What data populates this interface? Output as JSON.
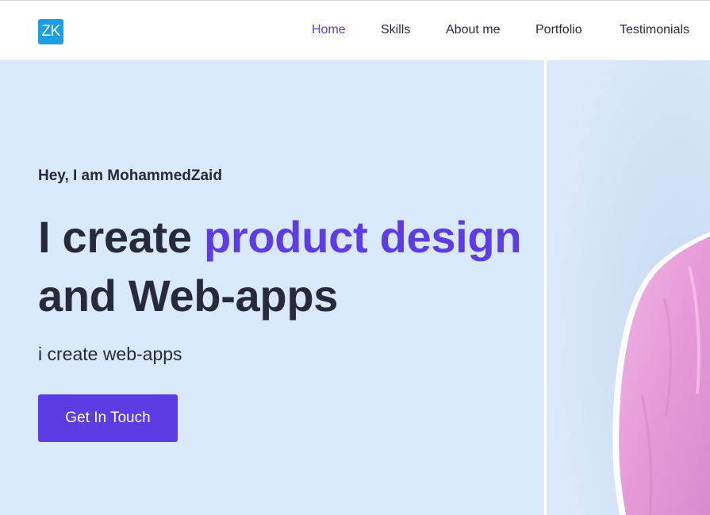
{
  "header": {
    "logo_text": "ZK",
    "logo_color": "#1e9de0",
    "nav": [
      {
        "label": "Home",
        "active": true
      },
      {
        "label": "Skills",
        "active": false
      },
      {
        "label": "About me",
        "active": false
      },
      {
        "label": "Portfolio",
        "active": false
      },
      {
        "label": "Testimonials",
        "active": false
      }
    ]
  },
  "hero": {
    "greeting": "Hey, I am MohammedZaid",
    "headline": {
      "part1": "I create ",
      "part2_accent": "product design",
      "part3": " and Web-apps"
    },
    "subline": "i create web-apps",
    "cta_label": "Get In Touch",
    "photo_icon": "person-photo"
  },
  "colors": {
    "accent": "#5d3ce3",
    "hero_background": "#dae8fc",
    "text": "#262a3b",
    "shirt": "#e9a3d9"
  }
}
